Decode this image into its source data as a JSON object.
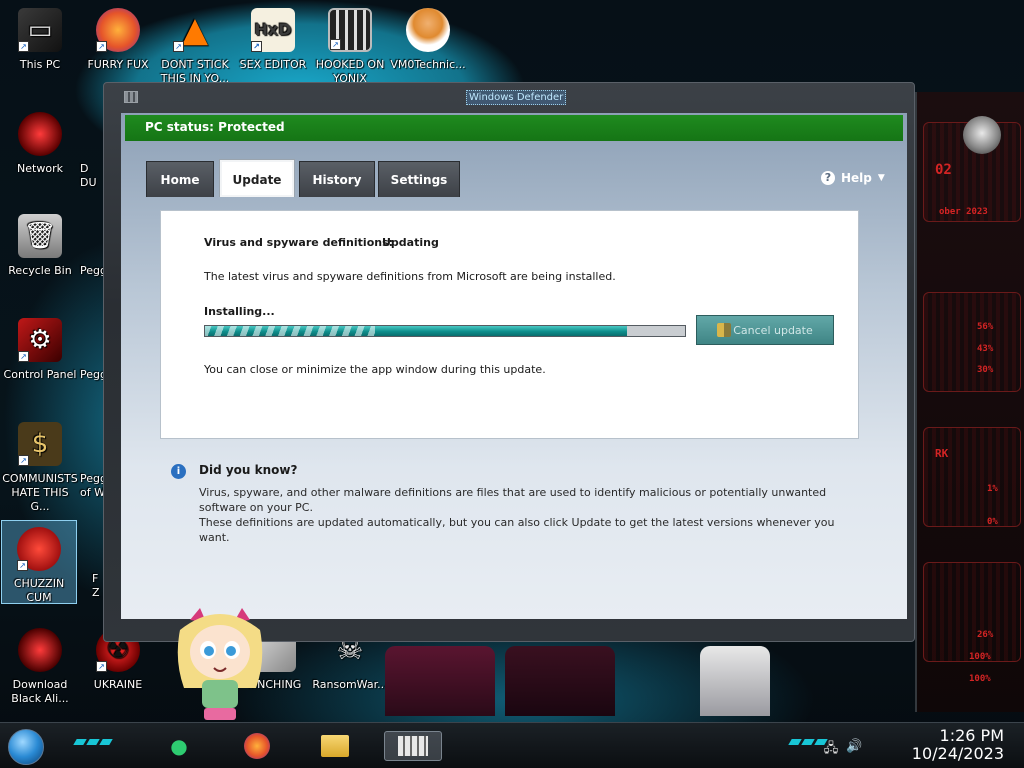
{
  "desktop": {
    "icons": [
      {
        "label": "This PC",
        "icon": "computer-icon"
      },
      {
        "label": "FURRY FUX",
        "icon": "firefox-icon"
      },
      {
        "label": "DONT STICK THIS IN YO...",
        "icon": "vlc-cone-icon"
      },
      {
        "label": "SEX EDITOR",
        "icon": "hxd-editor-icon"
      },
      {
        "label": "HOOKED ON YONIX",
        "icon": "maze-game-icon"
      },
      {
        "label": "VM0Technic...",
        "icon": "doctor-avatar-icon"
      },
      {
        "label": "Network",
        "icon": "network-orb-icon"
      },
      {
        "label": "Recycle Bin",
        "icon": "recycle-bin-icon"
      },
      {
        "label": "Control Panel",
        "icon": "control-panel-icon"
      },
      {
        "label": "COMMUNISTS HATE THIS G...",
        "icon": "money-bag-icon"
      },
      {
        "label": "CHUZZIN CUM",
        "icon": "chuzzle-icon"
      },
      {
        "label": "Download Black Ali...",
        "icon": "orb-icon"
      },
      {
        "label": "UKRAINE",
        "icon": "radiation-icon"
      },
      {
        "label": "...NCHING",
        "icon": "app-icon"
      },
      {
        "label": "RansomWar...",
        "icon": "skull-icon"
      }
    ],
    "partial_labels": [
      "D",
      "DU",
      "Pegg",
      "Pegg",
      "Pegg",
      "of W",
      "F",
      "Z"
    ]
  },
  "alien_panel": {
    "readouts": [
      "02",
      "ober 2023",
      "56%",
      "43%",
      "30%",
      "RK",
      "1%",
      "0%",
      "26%",
      "100%",
      "100%"
    ]
  },
  "window": {
    "title": "Windows Defender",
    "status_text": "PC status: Protected",
    "tabs": [
      {
        "label": "Home",
        "active": false
      },
      {
        "label": "Update",
        "active": true
      },
      {
        "label": "History",
        "active": false
      },
      {
        "label": "Settings",
        "active": false
      }
    ],
    "help_label": "Help",
    "panel": {
      "definitions_label": "Virus and spyware definitions:",
      "definitions_status": "Updating",
      "description": "The latest virus and spyware definitions from Microsoft are being installed.",
      "installing_label": "Installing...",
      "progress": 0.88,
      "cancel_label": "Cancel update",
      "close_hint": "You can close or minimize the app window during this update."
    },
    "did_you_know": {
      "heading": "Did you know?",
      "line1": "Virus, spyware, and other malware definitions are files that are used to identify malicious or potentially unwanted software on your PC.",
      "line2": "These definitions are updated automatically, but you can also click Update to get the latest versions whenever you want."
    }
  },
  "taskbar": {
    "items": [
      "notes-app-icon",
      "firefox-icon",
      "file-explorer-icon",
      "windows-defender-icon"
    ],
    "time": "1:26 PM",
    "date": "10/24/2023",
    "colors": {
      "status_green": "#1a851a",
      "accent_teal": "#18c6d6"
    }
  }
}
